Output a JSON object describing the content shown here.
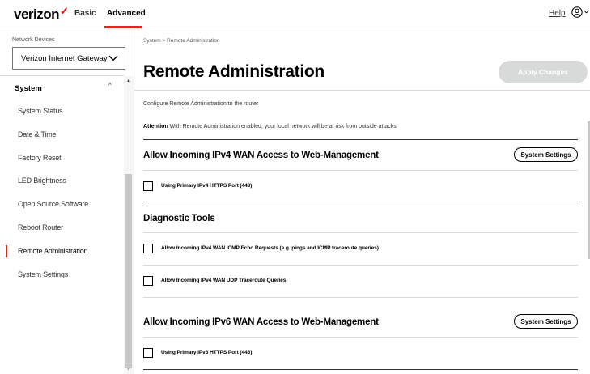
{
  "header": {
    "logo_text": "verizon",
    "logo_check": "✓",
    "tabs": [
      {
        "label": "Basic"
      },
      {
        "label": "Advanced"
      }
    ],
    "help_label": "Help",
    "accent_color": "#d52b1e"
  },
  "sidebar": {
    "network_devices_label": "Network Devices",
    "network_device_selected": "Verizon Internet Gateway",
    "section_label": "System",
    "items": [
      {
        "label": "System Status"
      },
      {
        "label": "Date & Time"
      },
      {
        "label": "Factory Reset"
      },
      {
        "label": "LED Brightness"
      },
      {
        "label": "Open Source Software"
      },
      {
        "label": "Reboot Router"
      },
      {
        "label": "Remote Administration"
      },
      {
        "label": "System Settings"
      }
    ],
    "active_item": "Remote Administration"
  },
  "main": {
    "breadcrumb": "System > Remote Administration",
    "title": "Remote Administration",
    "apply_label": "Apply Changes",
    "description": "Configure Remote Administration to the router",
    "attention_label": "Attention",
    "attention_text": "With Remote Administration enabled, your local network will be at risk from outside attacks",
    "ipv4_section": {
      "title": "Allow Incoming IPv4 WAN Access to Web-Management",
      "button": "System Settings",
      "checkbox_label": "Using Primary IPv4 HTTPS Port (443)",
      "checked": false
    },
    "diagnostic_section": {
      "title": "Diagnostic Tools",
      "checkboxes": [
        {
          "label": "Allow Incoming IPv4 WAN ICMP Echo Requests (e.g. pings and ICMP traceroute queries)",
          "checked": false
        },
        {
          "label": "Allow Incoming IPv4 WAN UDP Traceroute Queries",
          "checked": false
        }
      ]
    },
    "ipv6_section": {
      "title": "Allow Incoming IPv6 WAN Access to Web-Management",
      "button": "System Settings",
      "checkbox_label": "Using Primary IPv6 HTTPS Port (443)",
      "checked": false
    }
  }
}
